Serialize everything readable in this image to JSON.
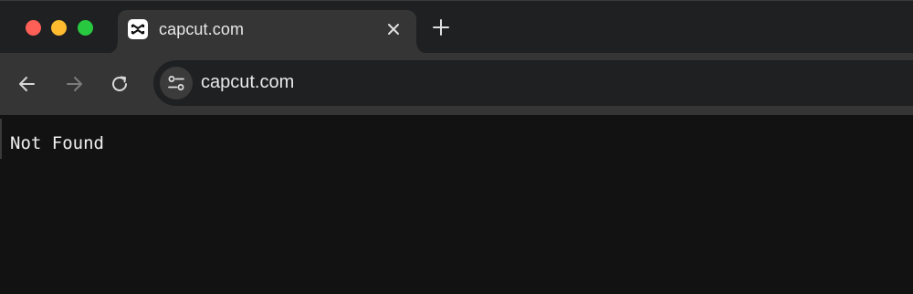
{
  "tab": {
    "title": "capcut.com",
    "favicon": "capcut-logo-icon"
  },
  "toolbar": {
    "url": "capcut.com",
    "site_info_icon": "tune-icon"
  },
  "page": {
    "message": "Not Found"
  },
  "colors": {
    "close": "#fe5f57",
    "minimize": "#febc2e",
    "maximize": "#28c840",
    "tab_active": "#353535",
    "tab_strip": "#1f2021",
    "page_bg": "#121212"
  }
}
